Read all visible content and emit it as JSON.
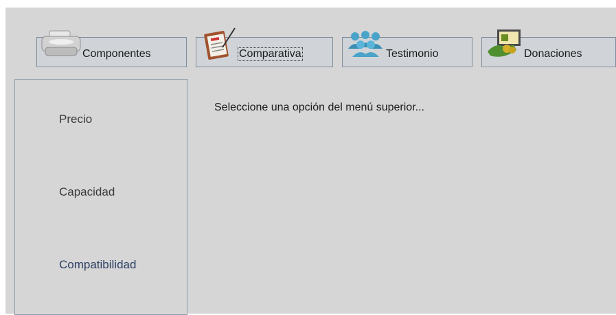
{
  "toolbar": {
    "componentes": {
      "label": "Componentes",
      "icon": "printer-icon"
    },
    "comparativa": {
      "label": "Comparativa",
      "icon": "clipboard-checklist-icon"
    },
    "testimonio": {
      "label": "Testimonio",
      "icon": "users-group-icon"
    },
    "donaciones": {
      "label": "Donaciones",
      "icon": "money-donation-icon"
    }
  },
  "sidebar": {
    "items": [
      {
        "label": "Precio"
      },
      {
        "label": "Capacidad"
      },
      {
        "label": "Compatibilidad"
      }
    ]
  },
  "main": {
    "message": "Seleccione una opción del menú superior..."
  },
  "colors": {
    "window_bg": "#d6d6d6",
    "button_bg": "#d0d4d8",
    "border": "#7f8c99",
    "selected_item_text": "#2c3e64"
  }
}
